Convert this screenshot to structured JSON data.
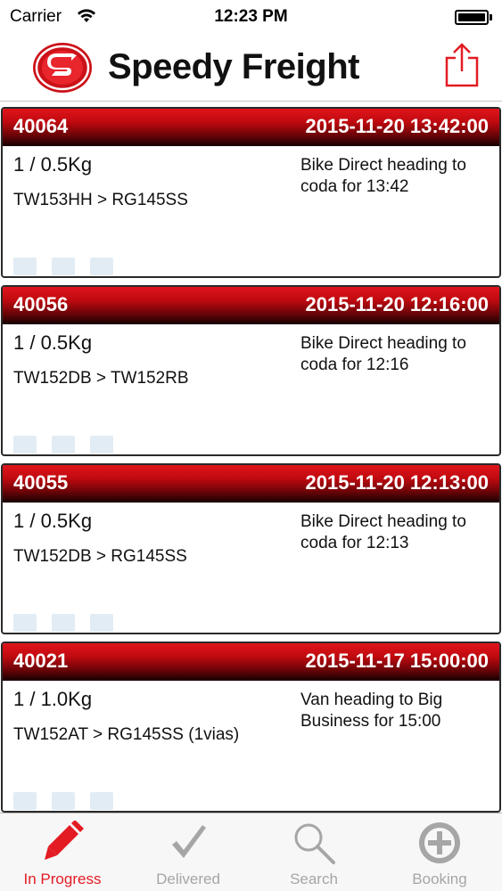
{
  "status_bar": {
    "carrier": "Carrier",
    "time": "12:23 PM",
    "battery_level": 1.0
  },
  "header": {
    "brand": "Speedy Freight",
    "logo_icon": "speedy-freight-logo",
    "share_icon": "share-icon"
  },
  "jobs": [
    {
      "id": "40064",
      "datetime": "2015-11-20 13:42:00",
      "weight": "1 / 0.5Kg",
      "route": "TW153HH > RG145SS",
      "status": "Bike Direct heading to coda for 13:42"
    },
    {
      "id": "40056",
      "datetime": "2015-11-20 12:16:00",
      "weight": "1 / 0.5Kg",
      "route": "TW152DB > TW152RB",
      "status": "Bike Direct heading to coda for 12:16"
    },
    {
      "id": "40055",
      "datetime": "2015-11-20 12:13:00",
      "weight": "1 / 0.5Kg",
      "route": "TW152DB > RG145SS",
      "status": "Bike Direct heading to coda for 12:13"
    },
    {
      "id": "40021",
      "datetime": "2015-11-17 15:00:00",
      "weight": "1 / 1.0Kg",
      "route": "TW152AT > RG145SS (1vias)",
      "status": "Van heading to Big Business for 15:00"
    }
  ],
  "tabs": [
    {
      "label": "In Progress",
      "icon": "pencil-icon",
      "active": true
    },
    {
      "label": "Delivered",
      "icon": "checkmark-icon",
      "active": false
    },
    {
      "label": "Search",
      "icon": "magnifier-icon",
      "active": false
    },
    {
      "label": "Booking",
      "icon": "plus-circle-icon",
      "active": false
    }
  ],
  "colors": {
    "accent": "#e31b23",
    "inactive": "#a6a6a6",
    "header_dark": "#160001"
  }
}
